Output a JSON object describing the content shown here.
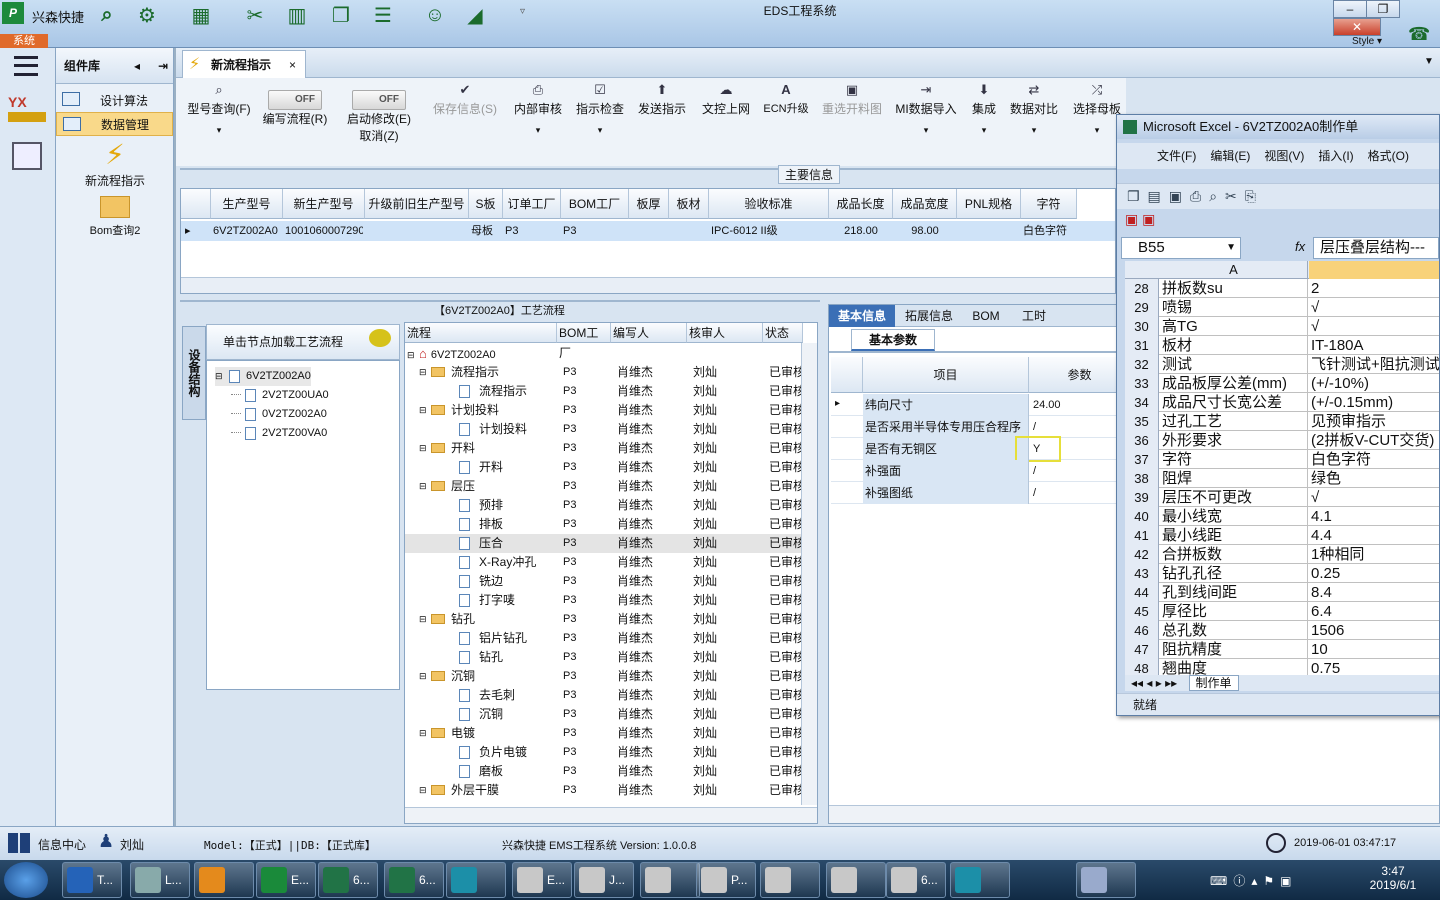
{
  "app": {
    "name": "兴森快捷",
    "window_title": "EDS工程系统",
    "system_tab": "系统",
    "style_label": "Style"
  },
  "nav": {
    "header": "组件库",
    "items": [
      {
        "label": "设计算法"
      },
      {
        "label": "数据管理"
      }
    ],
    "big_items": [
      {
        "label": "新流程指示"
      },
      {
        "label": "Bom查询2"
      }
    ]
  },
  "tab": {
    "label": "新流程指示",
    "close": "×"
  },
  "toolbar": {
    "buttons": [
      {
        "label": "型号查询(F)",
        "icon": "search-icon"
      },
      {
        "label": "编写流程(R)",
        "toggle": "OFF"
      },
      {
        "label": "启动修改(E)",
        "label2": "取消(Z)",
        "toggle": "OFF"
      },
      {
        "label": "保存信息(S)",
        "icon": "check-icon"
      },
      {
        "label": "内部审核",
        "icon": "print-icon"
      },
      {
        "label": "指示检查",
        "icon": "checkbox-icon"
      },
      {
        "label": "发送指示",
        "icon": "upload-icon"
      },
      {
        "label": "文控上网",
        "icon": "cloud-upload-icon"
      },
      {
        "label": "ECN升级",
        "icon": "letter-a-icon"
      },
      {
        "label": "重选开料图",
        "icon": "image-icon"
      },
      {
        "label": "MI数据导入",
        "icon": "import-icon"
      },
      {
        "label": "集成",
        "icon": "download-icon"
      },
      {
        "label": "数据对比",
        "icon": "compare-icon"
      },
      {
        "label": "选择母板",
        "icon": "shuffle-icon"
      }
    ]
  },
  "main_info": {
    "title": "主要信息",
    "columns": [
      "生产型号",
      "新生产型号",
      "升级前旧生产型号",
      "S板",
      "订单工厂",
      "BOM工厂",
      "板厚",
      "板材",
      "验收标准",
      "成品长度",
      "成品宽度",
      "PNL规格",
      "字符"
    ],
    "row": [
      "6V2TZ002A0",
      "10010600072902",
      "",
      "母板",
      "P3",
      "P3",
      "",
      "",
      "IPC-6012 II级",
      "218.00",
      "98.00",
      "",
      "白色字符"
    ]
  },
  "process": {
    "title": "【6V2TZ002A0】工艺流程",
    "side_tab": "设备结构",
    "node_tip": "单击节点加载工艺流程",
    "nodes": [
      {
        "label": "6V2TZ002A0"
      },
      {
        "label": "2V2TZ00UA0"
      },
      {
        "label": "0V2TZ002A0"
      },
      {
        "label": "2V2TZ00VA0"
      }
    ],
    "columns": [
      "流程",
      "BOM工厂",
      "编写人",
      "核审人",
      "状态"
    ],
    "root": "6V2TZ002A0",
    "rows": [
      {
        "name": "流程指示",
        "level": 1,
        "factory": "P3",
        "writer": "肖维杰",
        "reviewer": "刘灿",
        "status": "已审核"
      },
      {
        "name": "流程指示",
        "level": 2,
        "factory": "P3",
        "writer": "肖维杰",
        "reviewer": "刘灿",
        "status": "已审核"
      },
      {
        "name": "计划投料",
        "level": 1,
        "factory": "P3",
        "writer": "肖维杰",
        "reviewer": "刘灿",
        "status": "已审核"
      },
      {
        "name": "计划投料",
        "level": 2,
        "factory": "P3",
        "writer": "肖维杰",
        "reviewer": "刘灿",
        "status": "已审核"
      },
      {
        "name": "开料",
        "level": 1,
        "factory": "P3",
        "writer": "肖维杰",
        "reviewer": "刘灿",
        "status": "已审核"
      },
      {
        "name": "开料",
        "level": 2,
        "factory": "P3",
        "writer": "肖维杰",
        "reviewer": "刘灿",
        "status": "已审核"
      },
      {
        "name": "层压",
        "level": 1,
        "factory": "P3",
        "writer": "肖维杰",
        "reviewer": "刘灿",
        "status": "已审核"
      },
      {
        "name": "预排",
        "level": 2,
        "factory": "P3",
        "writer": "肖维杰",
        "reviewer": "刘灿",
        "status": "已审核"
      },
      {
        "name": "排板",
        "level": 2,
        "factory": "P3",
        "writer": "肖维杰",
        "reviewer": "刘灿",
        "status": "已审核"
      },
      {
        "name": "压合",
        "level": 2,
        "factory": "P3",
        "writer": "肖维杰",
        "reviewer": "刘灿",
        "status": "已审核"
      },
      {
        "name": "X-Ray冲孔",
        "level": 2,
        "factory": "P3",
        "writer": "肖维杰",
        "reviewer": "刘灿",
        "status": "已审核"
      },
      {
        "name": "铣边",
        "level": 2,
        "factory": "P3",
        "writer": "肖维杰",
        "reviewer": "刘灿",
        "status": "已审核"
      },
      {
        "name": "打字唛",
        "level": 2,
        "factory": "P3",
        "writer": "肖维杰",
        "reviewer": "刘灿",
        "status": "已审核"
      },
      {
        "name": "钻孔",
        "level": 1,
        "factory": "P3",
        "writer": "肖维杰",
        "reviewer": "刘灿",
        "status": "已审核"
      },
      {
        "name": "铝片钻孔",
        "level": 2,
        "factory": "P3",
        "writer": "肖维杰",
        "reviewer": "刘灿",
        "status": "已审核"
      },
      {
        "name": "钻孔",
        "level": 2,
        "factory": "P3",
        "writer": "肖维杰",
        "reviewer": "刘灿",
        "status": "已审核"
      },
      {
        "name": "沉铜",
        "level": 1,
        "factory": "P3",
        "writer": "肖维杰",
        "reviewer": "刘灿",
        "status": "已审核"
      },
      {
        "name": "去毛刺",
        "level": 2,
        "factory": "P3",
        "writer": "肖维杰",
        "reviewer": "刘灿",
        "status": "已审核"
      },
      {
        "name": "沉铜",
        "level": 2,
        "factory": "P3",
        "writer": "肖维杰",
        "reviewer": "刘灿",
        "status": "已审核"
      },
      {
        "name": "电镀",
        "level": 1,
        "factory": "P3",
        "writer": "肖维杰",
        "reviewer": "刘灿",
        "status": "已审核"
      },
      {
        "name": "负片电镀",
        "level": 2,
        "factory": "P3",
        "writer": "肖维杰",
        "reviewer": "刘灿",
        "status": "已审核"
      },
      {
        "name": "磨板",
        "level": 2,
        "factory": "P3",
        "writer": "肖维杰",
        "reviewer": "刘灿",
        "status": "已审核"
      },
      {
        "name": "外层干膜",
        "level": 1,
        "factory": "P3",
        "writer": "肖维杰",
        "reviewer": "刘灿",
        "status": "已审核"
      }
    ]
  },
  "detail": {
    "tabs": [
      "基本信息",
      "拓展信息",
      "BOM",
      "工时"
    ],
    "subtab": "基本参数",
    "columns": [
      "项目",
      "参数"
    ],
    "rows": [
      {
        "item": "纬向尺寸",
        "value": "24.00"
      },
      {
        "item": "是否采用半导体专用压合程序",
        "value": "/"
      },
      {
        "item": "是否有无铜区",
        "value": "Y"
      },
      {
        "item": "补强面",
        "value": "/"
      },
      {
        "item": "补强图纸",
        "value": "/"
      }
    ]
  },
  "excel": {
    "title": "Microsoft Excel - 6V2TZ002A0制作单",
    "menu": [
      "文件(F)",
      "编辑(E)",
      "视图(V)",
      "插入(I)",
      "格式(O)"
    ],
    "cell_ref": "B55",
    "formula": "层压叠层结构---",
    "col_a": "A",
    "sheet": "制作单",
    "status": "就绪",
    "rows": [
      {
        "n": "28",
        "a": "拼板数su",
        "b": "2"
      },
      {
        "n": "29",
        "a": "喷锡",
        "b": "√"
      },
      {
        "n": "30",
        "a": "高TG",
        "b": "√"
      },
      {
        "n": "31",
        "a": "板材",
        "b": "IT-180A"
      },
      {
        "n": "32",
        "a": "测试",
        "b": "飞针测试+阻抗测试"
      },
      {
        "n": "33",
        "a": "成品板厚公差(mm)",
        "b": "(+/-10%)"
      },
      {
        "n": "34",
        "a": "成品尺寸长宽公差",
        "b": "(+/-0.15mm)"
      },
      {
        "n": "35",
        "a": "过孔工艺",
        "b": "见预审指示"
      },
      {
        "n": "36",
        "a": "外形要求",
        "b": "(2拼板V-CUT交货)"
      },
      {
        "n": "37",
        "a": "字符",
        "b": "白色字符"
      },
      {
        "n": "38",
        "a": "阻焊",
        "b": "绿色"
      },
      {
        "n": "39",
        "a": "层压不可更改",
        "b": "√"
      },
      {
        "n": "40",
        "a": "最小线宽",
        "b": "4.1"
      },
      {
        "n": "41",
        "a": "最小线距",
        "b": "4.4"
      },
      {
        "n": "42",
        "a": "合拼板数",
        "b": "1种相同"
      },
      {
        "n": "43",
        "a": "钻孔孔径",
        "b": "0.25"
      },
      {
        "n": "44",
        "a": "孔到线间距",
        "b": "8.4"
      },
      {
        "n": "45",
        "a": "厚径比",
        "b": "6.4"
      },
      {
        "n": "46",
        "a": "总孔数",
        "b": "1506"
      },
      {
        "n": "47",
        "a": "阻抗精度",
        "b": "10"
      },
      {
        "n": "48",
        "a": "翘曲度",
        "b": "0.75"
      }
    ]
  },
  "statusbar": {
    "info_center": "信息中心",
    "user": "刘灿",
    "model_db": "Model:【正式】||DB:【正式库】",
    "version": "兴森快捷 EMS工程系统 Version: 1.0.0.8",
    "datetime": "2019-06-01 03:47:17"
  },
  "taskbar": {
    "apps": [
      {
        "label": "T...",
        "color": "#2563b8"
      },
      {
        "label": "L...",
        "color": "#8aa"
      },
      {
        "label": "",
        "color": "#e48a1c"
      },
      {
        "label": "E...",
        "color": "#1a8a3a"
      },
      {
        "label": "6...",
        "color": "#217346"
      },
      {
        "label": "6...",
        "color": "#217346"
      },
      {
        "label": "",
        "color": "#1c8fa8"
      },
      {
        "label": "E...",
        "color": "#c8c8c8"
      },
      {
        "label": "J...",
        "color": "#c8c8c8"
      },
      {
        "label": "",
        "color": "#c8c8c8"
      },
      {
        "label": "P...",
        "color": "#c8c8c8"
      },
      {
        "label": "",
        "color": "#c8c8c8"
      },
      {
        "label": "",
        "color": "#c8c8c8"
      },
      {
        "label": "6...",
        "color": "#c8c8c8"
      },
      {
        "label": "",
        "color": "#1c8fa8"
      },
      {
        "label": "",
        "color": "#9ac"
      }
    ],
    "time": "3:47",
    "date": "2019/6/1"
  }
}
